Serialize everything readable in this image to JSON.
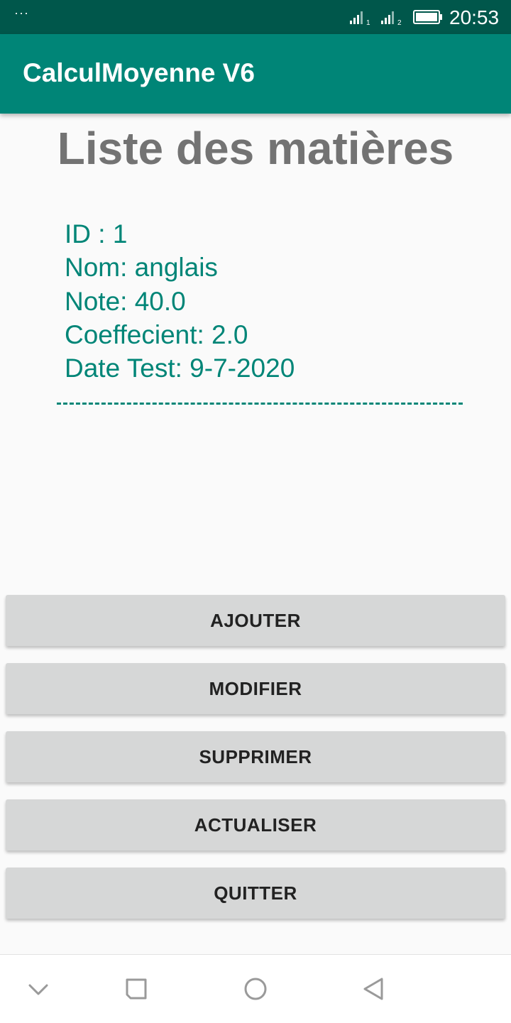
{
  "status_bar": {
    "notification_dots": "···",
    "sim1_label": "1",
    "sim2_label": "2",
    "time": "20:53",
    "icons": [
      "signal-sim1-icon",
      "signal-sim2-icon",
      "battery-icon"
    ]
  },
  "app_bar": {
    "title": "CalculMoyenne V6"
  },
  "main": {
    "heading": "Liste des matières",
    "record": {
      "id": "ID : 1",
      "name": "Nom: anglais",
      "grade": "Note: 40.0",
      "coefficient": "Coeffecient: 2.0",
      "test_date": "Date Test: 9-7-2020"
    }
  },
  "actions": {
    "add": "AJOUTER",
    "edit": "MODIFIER",
    "delete": "SUPPRIMER",
    "refresh": "ACTUALISER",
    "quit": "QUITTER"
  },
  "nav_bar": {
    "icons": [
      "chevron-down-icon",
      "recents-square-icon",
      "home-circle-icon",
      "back-triangle-icon"
    ]
  },
  "colors": {
    "status_bar": "#00574b",
    "app_bar": "#008577",
    "accent_text": "#008577",
    "heading_text": "#737373",
    "button_bg": "#d6d7d7"
  }
}
